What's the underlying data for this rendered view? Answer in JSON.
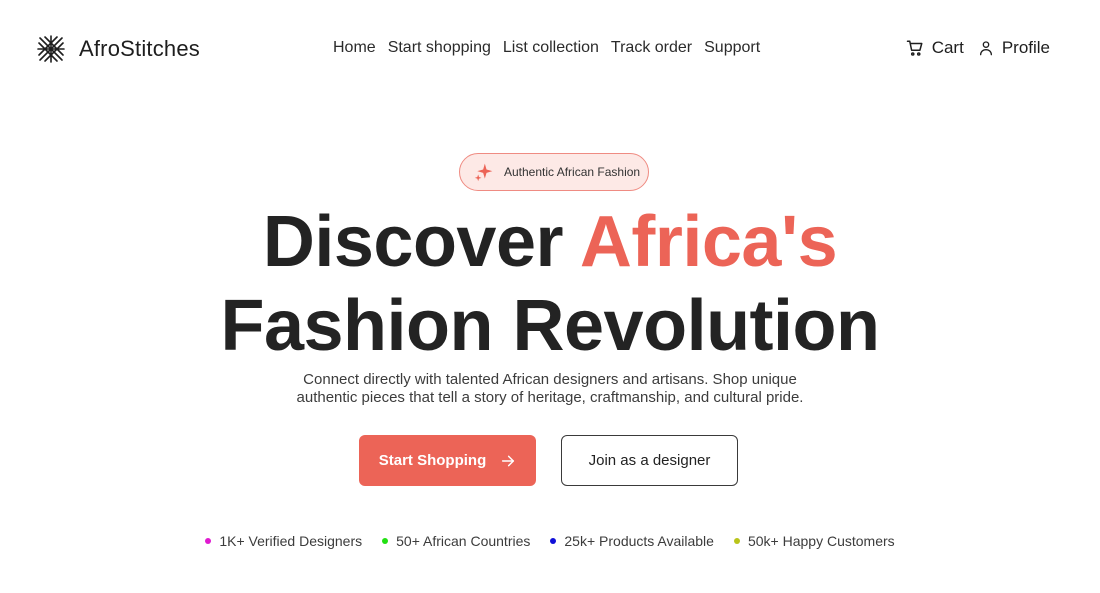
{
  "brand": {
    "name": "AfroStitches"
  },
  "nav": {
    "items": [
      {
        "label": "Home"
      },
      {
        "label": "Start shopping"
      },
      {
        "label": "List collection"
      },
      {
        "label": "Track order"
      },
      {
        "label": "Support"
      }
    ]
  },
  "actions": {
    "cart_label": "Cart",
    "profile_label": "Profile"
  },
  "hero": {
    "badge_label": "Authentic African Fashion",
    "headline_part1": "Discover ",
    "headline_accent": "Africa's",
    "headline_line2": "Fashion Revolution",
    "subtitle_line1": "Connect directly with talented African designers and artisans. Shop unique",
    "subtitle_line2": "authentic pieces that tell a story of heritage, craftmanship, and cultural pride.",
    "primary_button": "Start Shopping",
    "secondary_button": "Join as a designer"
  },
  "stats": [
    {
      "label": "1K+ Verified Designers",
      "color": "#e01ad0"
    },
    {
      "label": "50+ African Countries",
      "color": "#22e012"
    },
    {
      "label": "25k+ Products Available",
      "color": "#1010d8"
    },
    {
      "label": "50k+ Happy Customers",
      "color": "#b9c41a"
    }
  ],
  "colors": {
    "accent": "#ec6457",
    "badge_bg": "#fde9e6",
    "badge_border": "#ef8b82",
    "text_dark": "#232323"
  },
  "icons": {
    "logo": "woven-star-icon",
    "badge": "sparkle-icon",
    "cart": "cart-icon",
    "profile": "user-icon",
    "primary_button": "arrow-right-icon"
  }
}
